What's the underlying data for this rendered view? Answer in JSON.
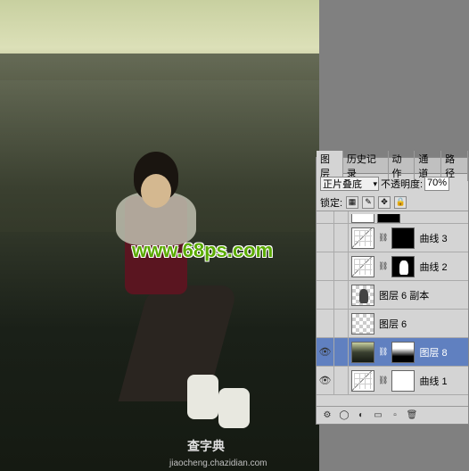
{
  "canvas": {
    "watermark_main": "www.68ps.com",
    "watermark_bottom1": "查字典",
    "watermark_bottom2": "jiaocheng.chazidian.com"
  },
  "panel": {
    "tabs": {
      "layers": "图层",
      "history": "历史记录",
      "actions": "动作",
      "channels": "通道",
      "paths": "路径"
    },
    "blend_mode": "正片叠底",
    "opacity_label": "不透明度:",
    "opacity_value": "70%",
    "lock_label": "锁定:",
    "layers": [
      {
        "name": "曲线 3",
        "visible": false,
        "type": "curves",
        "mask": "black"
      },
      {
        "name": "曲线 2",
        "visible": false,
        "type": "curves",
        "mask": "figure"
      },
      {
        "name": "图层 6 副本",
        "visible": false,
        "type": "trans-fig"
      },
      {
        "name": "图层 6",
        "visible": false,
        "type": "trans"
      },
      {
        "name": "图层 8",
        "visible": true,
        "type": "image",
        "mask": "grad",
        "selected": true
      },
      {
        "name": "曲线 1",
        "visible": true,
        "type": "curves",
        "mask": "white"
      }
    ]
  }
}
